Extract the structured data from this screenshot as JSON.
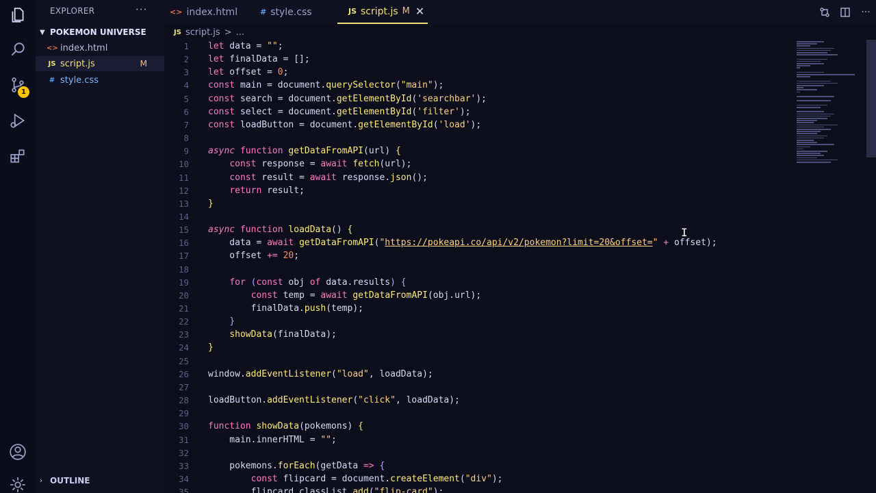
{
  "sidebar": {
    "title": "EXPLORER",
    "more": "···",
    "folder": "POKEMON UNIVERSE",
    "files": [
      {
        "icon": "<>",
        "name": "index.html",
        "mod": ""
      },
      {
        "icon": "JS",
        "name": "script.js",
        "mod": "M"
      },
      {
        "icon": "#",
        "name": "style.css",
        "mod": ""
      }
    ],
    "outline": "OUTLINE"
  },
  "activity": {
    "badge": "1"
  },
  "tabs": [
    {
      "icon": "<>",
      "label": "index.html"
    },
    {
      "icon": "#",
      "label": "style.css"
    },
    {
      "icon": "JS",
      "label": "script.js",
      "mod": "M",
      "close": "✕"
    }
  ],
  "breadcrumb": {
    "icon": "JS",
    "file": "script.js",
    "sep": ">",
    "rest": "..."
  },
  "editor": {
    "lines": [
      {
        "n": "1",
        "html": "<span class='k'>let</span> data = <span class='s'>\"\"</span>;"
      },
      {
        "n": "2",
        "html": "<span class='k'>let</span> finalData = [];"
      },
      {
        "n": "3",
        "html": "<span class='k'>let</span> offset = <span class='n'>0</span>;"
      },
      {
        "n": "4",
        "html": "<span class='k'>const</span> main = document.<span class='f'>querySelector</span>(<span class='s'>\"main\"</span>);"
      },
      {
        "n": "5",
        "html": "<span class='k'>const</span> search = document.<span class='f'>getElementById</span>(<span class='s'>'searchbar'</span>);"
      },
      {
        "n": "6",
        "html": "<span class='k'>const</span> select = document.<span class='f'>getElementById</span>(<span class='s'>'filter'</span>);"
      },
      {
        "n": "7",
        "html": "<span class='k'>const</span> loadButton = document.<span class='f'>getElementById</span>(<span class='s'>'load'</span>);"
      },
      {
        "n": "8",
        "html": ""
      },
      {
        "n": "9",
        "html": "<span class='it'>async</span> <span class='k'>function</span> <span class='f'>getDataFromAPI</span>(url) <span class='f'>{</span>"
      },
      {
        "n": "10",
        "html": "    <span class='k'>const</span> response = <span class='k'>await</span> <span class='f'>fetch</span>(url);"
      },
      {
        "n": "11",
        "html": "    <span class='k'>const</span> result = <span class='k'>await</span> response.<span class='f'>json</span>();"
      },
      {
        "n": "12",
        "html": "    <span class='k'>return</span> result;"
      },
      {
        "n": "13",
        "html": "<span class='f'>}</span>"
      },
      {
        "n": "14",
        "html": ""
      },
      {
        "n": "15",
        "html": "<span class='it'>async</span> <span class='k'>function</span> <span class='f'>loadData</span>() <span class='f'>{</span>"
      },
      {
        "n": "16",
        "html": "    data = <span class='k'>await</span> <span class='f'>getDataFromAPI</span>(<span class='s'>\"</span><span class='u'>https://pokeapi.co/api/v2/pokemon?limit=20&amp;offset=</span><span class='s'>\"</span> <span class='k'>+</span> offset);"
      },
      {
        "n": "17",
        "html": "    offset <span class='k'>+=</span> <span class='n'>20</span>;"
      },
      {
        "n": "18",
        "html": ""
      },
      {
        "n": "19",
        "html": "    <span class='k'>for</span> <span class='p'>(</span><span class='k'>const</span> obj <span class='k'>of</span> data.results<span class='p'>)</span> <span class='p'>{</span>"
      },
      {
        "n": "20",
        "html": "        <span class='k'>const</span> temp = <span class='k'>await</span> <span class='f'>getDataFromAPI</span>(obj.url);"
      },
      {
        "n": "21",
        "html": "        finalData.<span class='f'>push</span>(temp);"
      },
      {
        "n": "22",
        "html": "    <span class='p'>}</span>"
      },
      {
        "n": "23",
        "html": "    <span class='f'>showData</span>(finalData);"
      },
      {
        "n": "24",
        "html": "<span class='f'>}</span>"
      },
      {
        "n": "25",
        "html": ""
      },
      {
        "n": "26",
        "html": "window.<span class='f'>addEventListener</span>(<span class='s'>\"load\"</span>, loadData);"
      },
      {
        "n": "27",
        "html": ""
      },
      {
        "n": "28",
        "html": "loadButton.<span class='f'>addEventListener</span>(<span class='s'>\"click\"</span>, loadData);"
      },
      {
        "n": "29",
        "html": ""
      },
      {
        "n": "30",
        "html": "<span class='k'>function</span> <span class='f'>showData</span>(pokemons) <span class='f'>{</span>"
      },
      {
        "n": "31",
        "html": "    main.innerHTML = <span class='s'>\"\"</span>;"
      },
      {
        "n": "32",
        "html": ""
      },
      {
        "n": "33",
        "html": "    pokemons.<span class='f'>forEach</span>(getData <span class='k'>=&gt;</span> <span class='p'>{</span>"
      },
      {
        "n": "34",
        "html": "        <span class='k'>const</span> flipcard = document.<span class='f'>createElement</span>(<span class='s'>\"div\"</span>);"
      },
      {
        "n": "35",
        "html": "        flipcard.classList.<span class='f'>add</span>(<span class='s'>\"flip-card\"</span>);"
      }
    ]
  },
  "colors": {
    "accent": "#f0e077",
    "keyword": "#ff79c6",
    "function": "#ffea7a",
    "string": "#ffd27f",
    "number": "#ff8c5a",
    "badge": "#ffc400"
  },
  "icons": [
    "files-icon",
    "search-icon",
    "source-control-icon",
    "run-debug-icon",
    "extensions-icon",
    "account-icon",
    "gear-icon"
  ]
}
